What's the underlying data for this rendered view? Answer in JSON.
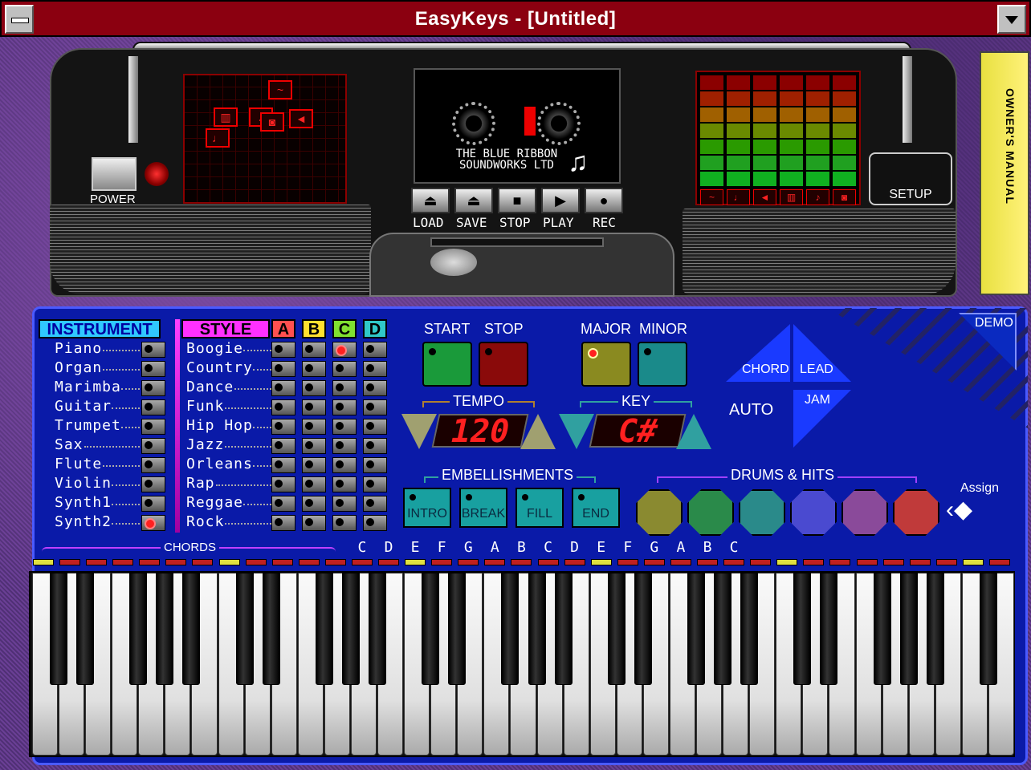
{
  "window": {
    "title": "EasyKeys - [Untitled]"
  },
  "boombox": {
    "power_label": "POWER",
    "cassette_brand_line1": "THE BLUE RIBBON",
    "cassette_brand_line2": "SOUNDWORKS LTD",
    "transport": [
      {
        "label": "LOAD",
        "icon": "eject-icon"
      },
      {
        "label": "SAVE",
        "icon": "save-icon"
      },
      {
        "label": "STOP",
        "icon": "stop-icon"
      },
      {
        "label": "PLAY",
        "icon": "play-icon"
      },
      {
        "label": "REC",
        "icon": "record-icon"
      }
    ],
    "setup_label": "SETUP",
    "manual_label": "OWNER'S MANUAL",
    "grid_icons": [
      "wave-icon",
      "keyboard-icon",
      "guitar-icon",
      "drum-icon",
      "horn-icon",
      "sax-icon"
    ],
    "eq_icons": [
      "wave-icon",
      "sax-icon",
      "horn-icon",
      "keyboard-icon",
      "guitar-icon",
      "drum-icon"
    ]
  },
  "instruments": {
    "heading": "INSTRUMENT",
    "items": [
      "Piano",
      "Organ",
      "Marimba",
      "Guitar",
      "Trumpet",
      "Sax",
      "Flute",
      "Violin",
      "Synth1",
      "Synth2"
    ],
    "selected": "Synth2"
  },
  "styles": {
    "heading": "STYLE",
    "variants": [
      "A",
      "B",
      "C",
      "D"
    ],
    "items": [
      "Boogie",
      "Country",
      "Dance",
      "Funk",
      "Hip Hop",
      "Jazz",
      "Orleans",
      "Rap",
      "Reggae",
      "Rock"
    ],
    "selected": {
      "style": "Boogie",
      "variant": "C"
    }
  },
  "controls": {
    "start": "START",
    "stop": "STOP",
    "major": "MAJOR",
    "minor": "MINOR",
    "tempo_label": "TEMPO",
    "tempo_value": "120",
    "key_label": "KEY",
    "key_value": "C#",
    "chord": "CHORD",
    "lead": "LEAD",
    "auto": "AUTO",
    "jam": "JAM",
    "demo": "DEMO",
    "embellishments_label": "EMBELLISHMENTS",
    "embellishments": [
      "INTRO",
      "BREAK",
      "FILL",
      "END"
    ],
    "drums_label": "DRUMS & HITS",
    "drum_colors": [
      "#8a8a30",
      "#2a8a4a",
      "#2a8a8a",
      "#4a4ad0",
      "#8a4a9a",
      "#c03a3a"
    ],
    "assign": "Assign"
  },
  "keyboard": {
    "chords_label": "CHORDS",
    "note_labels": [
      "C",
      "D",
      "E",
      "F",
      "G",
      "A",
      "B",
      "C",
      "D",
      "E",
      "F",
      "G",
      "A",
      "B",
      "C"
    ],
    "white_key_count": 37
  }
}
